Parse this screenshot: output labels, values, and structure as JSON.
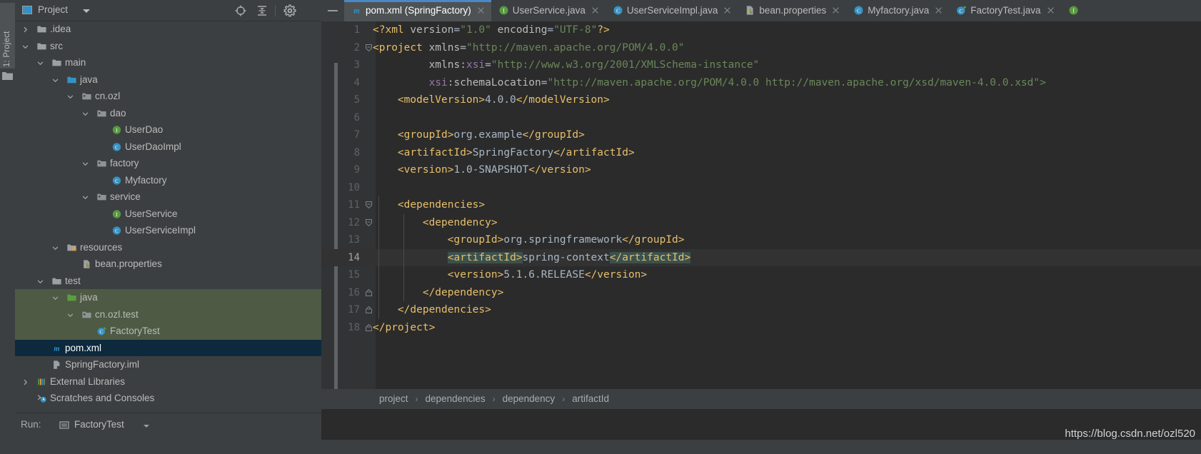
{
  "tool_strip": {
    "label": "1: Project",
    "folder_icon": "folder-icon"
  },
  "project_panel": {
    "title": "Project",
    "dropdown_icon": "chevron-down-icon",
    "buttons": [
      {
        "name": "locate-icon",
        "label": "Select Opened File"
      },
      {
        "name": "collapse-all-icon",
        "label": "Collapse All"
      },
      {
        "name": "gear-icon",
        "label": "Settings"
      }
    ],
    "tree": [
      {
        "label": ".idea",
        "depth": 1,
        "arrow": "right",
        "icon": "folder",
        "state": "none"
      },
      {
        "label": "src",
        "depth": 1,
        "arrow": "down",
        "icon": "folder",
        "state": "none"
      },
      {
        "label": "main",
        "depth": 2,
        "arrow": "down",
        "icon": "folder",
        "state": "none"
      },
      {
        "label": "java",
        "depth": 3,
        "arrow": "down",
        "icon": "folder-source",
        "state": "none"
      },
      {
        "label": "cn.ozl",
        "depth": 4,
        "arrow": "down",
        "icon": "package",
        "state": "none"
      },
      {
        "label": "dao",
        "depth": 5,
        "arrow": "down",
        "icon": "package",
        "state": "none"
      },
      {
        "label": "UserDao",
        "depth": 6,
        "arrow": "none",
        "icon": "interface",
        "state": "none"
      },
      {
        "label": "UserDaoImpl",
        "depth": 6,
        "arrow": "none",
        "icon": "class",
        "state": "none"
      },
      {
        "label": "factory",
        "depth": 5,
        "arrow": "down",
        "icon": "package",
        "state": "none"
      },
      {
        "label": "Myfactory",
        "depth": 6,
        "arrow": "none",
        "icon": "class",
        "state": "none"
      },
      {
        "label": "service",
        "depth": 5,
        "arrow": "down",
        "icon": "package",
        "state": "none"
      },
      {
        "label": "UserService",
        "depth": 6,
        "arrow": "none",
        "icon": "interface",
        "state": "none"
      },
      {
        "label": "UserServiceImpl",
        "depth": 6,
        "arrow": "none",
        "icon": "class",
        "state": "none"
      },
      {
        "label": "resources",
        "depth": 3,
        "arrow": "down",
        "icon": "folder-res",
        "state": "none"
      },
      {
        "label": "bean.properties",
        "depth": 4,
        "arrow": "none",
        "icon": "properties",
        "state": "none"
      },
      {
        "label": "test",
        "depth": 2,
        "arrow": "down",
        "icon": "folder",
        "state": "none"
      },
      {
        "label": "java",
        "depth": 3,
        "arrow": "down",
        "icon": "folder-test",
        "state": "green"
      },
      {
        "label": "cn.ozl.test",
        "depth": 4,
        "arrow": "down",
        "icon": "package",
        "state": "green"
      },
      {
        "label": "FactoryTest",
        "depth": 5,
        "arrow": "none",
        "icon": "class-test",
        "state": "green"
      },
      {
        "label": "pom.xml",
        "depth": 2,
        "arrow": "none",
        "icon": "maven",
        "state": "selected"
      },
      {
        "label": "SpringFactory.iml",
        "depth": 2,
        "arrow": "none",
        "icon": "iml",
        "state": "none"
      },
      {
        "label": "External Libraries",
        "depth": 1,
        "arrow": "right",
        "icon": "libraries",
        "state": "none"
      },
      {
        "label": "Scratches and Consoles",
        "depth": 1,
        "arrow": "none",
        "icon": "scratches",
        "state": "none"
      }
    ]
  },
  "run_bar": {
    "label": "Run:",
    "tab_label": "FactoryTest",
    "tab_icon": "run-config-icon",
    "caret_icon": "chevron-down-icon"
  },
  "editor": {
    "minimize_icon": "minimize-icon",
    "tabs": [
      {
        "label": "pom.xml (SpringFactory)",
        "icon": "maven",
        "active": true
      },
      {
        "label": "UserService.java",
        "icon": "interface",
        "active": false
      },
      {
        "label": "UserServiceImpl.java",
        "icon": "class",
        "active": false
      },
      {
        "label": "bean.properties",
        "icon": "properties",
        "active": false
      },
      {
        "label": "Myfactory.java",
        "icon": "class",
        "active": false
      },
      {
        "label": "FactoryTest.java",
        "icon": "class-test",
        "active": false
      }
    ],
    "overflow_tab_icon": "interface",
    "current_line": 14,
    "lines": [
      {
        "n": 1,
        "fold": "none",
        "indent": 0,
        "parts": [
          {
            "t": "<?xml ",
            "c": "s-tag"
          },
          {
            "t": "version",
            "c": "s-attr"
          },
          {
            "t": "=",
            "c": "s-op"
          },
          {
            "t": "\"1.0\"",
            "c": "s-val"
          },
          {
            "t": " ",
            "c": "s-op"
          },
          {
            "t": "encoding",
            "c": "s-attr"
          },
          {
            "t": "=",
            "c": "s-op"
          },
          {
            "t": "\"UTF-8\"",
            "c": "s-val"
          },
          {
            "t": "?>",
            "c": "s-tag"
          }
        ]
      },
      {
        "n": 2,
        "fold": "open",
        "indent": 0,
        "parts": [
          {
            "t": "<project ",
            "c": "s-tag"
          },
          {
            "t": "xmlns",
            "c": "s-attr"
          },
          {
            "t": "=",
            "c": "s-op"
          },
          {
            "t": "\"http://maven.apache.org/POM/4.0.0\"",
            "c": "s-val"
          }
        ]
      },
      {
        "n": 3,
        "fold": "none",
        "indent": 0,
        "parts": [
          {
            "t": "         ",
            "c": "s-op"
          },
          {
            "t": "xmlns",
            "c": "s-attr"
          },
          {
            "t": ":",
            "c": "s-op"
          },
          {
            "t": "xsi",
            "c": "s-ns"
          },
          {
            "t": "=",
            "c": "s-op"
          },
          {
            "t": "\"http://www.w3.org/2001/XMLSchema-instance\"",
            "c": "s-val"
          }
        ]
      },
      {
        "n": 4,
        "fold": "none",
        "indent": 0,
        "parts": [
          {
            "t": "         ",
            "c": "s-op"
          },
          {
            "t": "xsi",
            "c": "s-ns"
          },
          {
            "t": ":",
            "c": "s-op"
          },
          {
            "t": "schemaLocation",
            "c": "s-attr"
          },
          {
            "t": "=",
            "c": "s-op"
          },
          {
            "t": "\"http://maven.apache.org/POM/4.0.0 http://maven.apache.org/xsd/maven-4.0.0.xsd\">",
            "c": "s-val"
          }
        ]
      },
      {
        "n": 5,
        "fold": "none",
        "indent": 0,
        "parts": [
          {
            "t": "    ",
            "c": "s-op"
          },
          {
            "t": "<modelVersion>",
            "c": "s-tag"
          },
          {
            "t": "4.0.0",
            "c": "s-txt"
          },
          {
            "t": "</modelVersion>",
            "c": "s-tag"
          }
        ]
      },
      {
        "n": 6,
        "fold": "none",
        "indent": 0,
        "parts": []
      },
      {
        "n": 7,
        "fold": "none",
        "indent": 0,
        "parts": [
          {
            "t": "    ",
            "c": "s-op"
          },
          {
            "t": "<groupId>",
            "c": "s-tag"
          },
          {
            "t": "org.example",
            "c": "s-txt"
          },
          {
            "t": "</groupId>",
            "c": "s-tag"
          }
        ]
      },
      {
        "n": 8,
        "fold": "none",
        "indent": 0,
        "parts": [
          {
            "t": "    ",
            "c": "s-op"
          },
          {
            "t": "<artifactId>",
            "c": "s-tag"
          },
          {
            "t": "SpringFactory",
            "c": "s-txt"
          },
          {
            "t": "</artifactId>",
            "c": "s-tag"
          }
        ]
      },
      {
        "n": 9,
        "fold": "none",
        "indent": 0,
        "parts": [
          {
            "t": "    ",
            "c": "s-op"
          },
          {
            "t": "<version>",
            "c": "s-tag"
          },
          {
            "t": "1.0-SNAPSHOT",
            "c": "s-txt"
          },
          {
            "t": "</version>",
            "c": "s-tag"
          }
        ]
      },
      {
        "n": 10,
        "fold": "none",
        "indent": 0,
        "parts": []
      },
      {
        "n": 11,
        "fold": "open",
        "indent": 1,
        "parts": [
          {
            "t": "    ",
            "c": "s-op"
          },
          {
            "t": "<dependencies>",
            "c": "s-tag"
          }
        ]
      },
      {
        "n": 12,
        "fold": "open",
        "indent": 2,
        "parts": [
          {
            "t": "        ",
            "c": "s-op"
          },
          {
            "t": "<dependency>",
            "c": "s-tag"
          }
        ]
      },
      {
        "n": 13,
        "fold": "none",
        "indent": 2,
        "parts": [
          {
            "t": "            ",
            "c": "s-op"
          },
          {
            "t": "<groupId>",
            "c": "s-tag"
          },
          {
            "t": "org.springframework",
            "c": "s-txt"
          },
          {
            "t": "</groupId>",
            "c": "s-tag"
          }
        ]
      },
      {
        "n": 14,
        "fold": "none",
        "indent": 2,
        "parts": [
          {
            "t": "            ",
            "c": "s-op"
          },
          {
            "t": "<artifactId>",
            "c": "s-tag hl-match"
          },
          {
            "t": "spring-context",
            "c": "s-txt"
          },
          {
            "t": "</artifactId>",
            "c": "s-tag hl-match"
          }
        ]
      },
      {
        "n": 15,
        "fold": "none",
        "indent": 2,
        "parts": [
          {
            "t": "            ",
            "c": "s-op"
          },
          {
            "t": "<version>",
            "c": "s-tag"
          },
          {
            "t": "5.1.6.RELEASE",
            "c": "s-txt"
          },
          {
            "t": "</version>",
            "c": "s-tag"
          }
        ]
      },
      {
        "n": 16,
        "fold": "close",
        "indent": 2,
        "parts": [
          {
            "t": "        ",
            "c": "s-op"
          },
          {
            "t": "</dependency>",
            "c": "s-tag"
          }
        ]
      },
      {
        "n": 17,
        "fold": "close",
        "indent": 1,
        "parts": [
          {
            "t": "    ",
            "c": "s-op"
          },
          {
            "t": "</dependencies>",
            "c": "s-tag"
          }
        ]
      },
      {
        "n": 18,
        "fold": "close",
        "indent": 0,
        "parts": [
          {
            "t": "</project>",
            "c": "s-tag"
          }
        ]
      }
    ],
    "breadcrumb": [
      "project",
      "dependencies",
      "dependency",
      "artifactId"
    ],
    "breadcrumb_separator": "›"
  },
  "watermark": "https://blog.csdn.net/ozl520",
  "colors": {
    "panel_bg": "#3c3f41",
    "editor_bg": "#2b2b2b",
    "gutter_bg": "#313335",
    "selection_blue": "#0d293e",
    "test_green": "#4e5a43",
    "tab_active": "#4e5254",
    "tab_underline": "#4a88c7",
    "match_highlight": "#3b514d",
    "tag": "#e8bf6a",
    "value": "#6a8759",
    "namespace": "#9876aa",
    "text": "#a9b7c6"
  }
}
